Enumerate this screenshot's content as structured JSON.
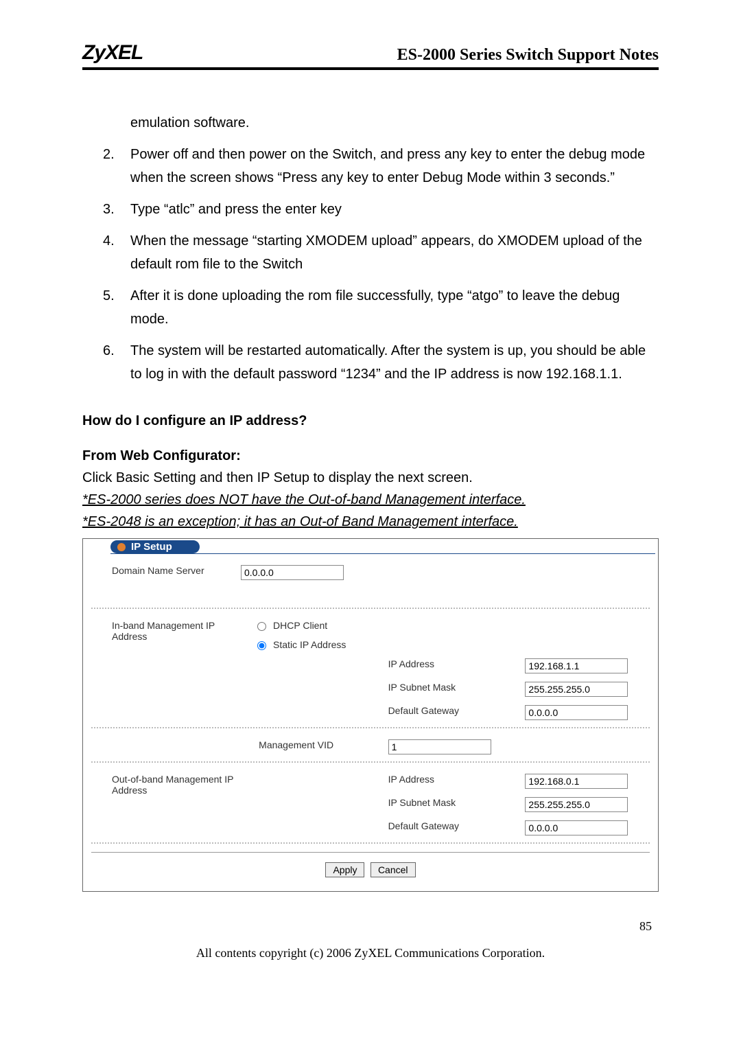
{
  "header": {
    "logo": "ZyXEL",
    "title": "ES-2000 Series Switch Support Notes"
  },
  "continuation": "emulation software.",
  "steps": [
    {
      "num": "2.",
      "text": "Power off and then power on the Switch, and press any key to enter the debug mode when the screen shows “Press any key to enter Debug Mode within 3 seconds.”"
    },
    {
      "num": "3.",
      "text": "Type “atlc” and press the enter key"
    },
    {
      "num": "4.",
      "text": "When the message “starting XMODEM upload” appears, do XMODEM upload of the default rom file to the Switch"
    },
    {
      "num": "5.",
      "text": "After it is done uploading the rom file successfully, type “atgo” to leave the debug mode."
    },
    {
      "num": "6.",
      "text": "The system will be restarted automatically. After the system is up, you should be able to log in with the default password “1234” and the IP address is now 192.168.1.1."
    }
  ],
  "section_title": "How do I configure an IP address?",
  "sub_title": "From Web Configurator:",
  "instruction": "Click Basic Setting and then IP Setup to display the next screen.",
  "note1": "*ES-2000 series does NOT have the Out-of-band Management interface.",
  "note2": "*ES-2048 is an exception; it has an Out-of Band Management interface.",
  "panel": {
    "title": "IP Setup",
    "dns_label": "Domain Name Server",
    "dns_value": "0.0.0.0",
    "inband_label": "In-band Management IP Address",
    "dhcp_label": "DHCP Client",
    "static_label": "Static IP Address",
    "ip_address_label": "IP Address",
    "ip_subnet_label": "IP Subnet Mask",
    "gateway_label": "Default Gateway",
    "mgmt_vid_label": "Management VID",
    "inband_ip": "192.168.1.1",
    "inband_mask": "255.255.255.0",
    "inband_gw": "0.0.0.0",
    "mgmt_vid": "1",
    "outband_label": "Out-of-band Management IP Address",
    "outband_ip": "192.168.0.1",
    "outband_mask": "255.255.255.0",
    "outband_gw": "0.0.0.0",
    "apply": "Apply",
    "cancel": "Cancel"
  },
  "page_number": "85",
  "footer": "All contents copyright (c) 2006 ZyXEL Communications Corporation."
}
